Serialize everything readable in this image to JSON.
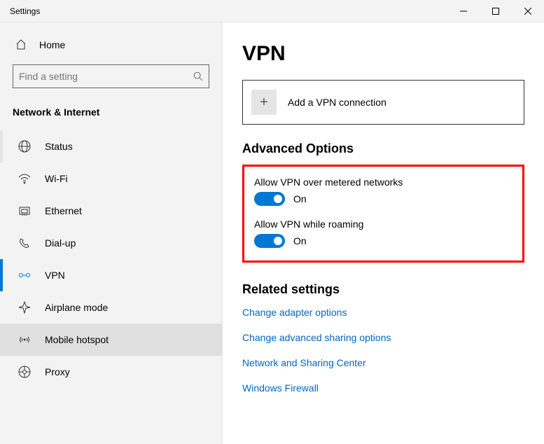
{
  "window": {
    "title": "Settings"
  },
  "sidebar": {
    "home": "Home",
    "search_placeholder": "Find a setting",
    "section": "Network & Internet",
    "items": [
      {
        "label": "Status"
      },
      {
        "label": "Wi-Fi"
      },
      {
        "label": "Ethernet"
      },
      {
        "label": "Dial-up"
      },
      {
        "label": "VPN"
      },
      {
        "label": "Airplane mode"
      },
      {
        "label": "Mobile hotspot"
      },
      {
        "label": "Proxy"
      }
    ]
  },
  "main": {
    "title": "VPN",
    "add_button": "Add a VPN connection",
    "advanced_title": "Advanced Options",
    "opt1_label": "Allow VPN over metered networks",
    "opt1_state": "On",
    "opt2_label": "Allow VPN while roaming",
    "opt2_state": "On",
    "related_title": "Related settings",
    "links": [
      "Change adapter options",
      "Change advanced sharing options",
      "Network and Sharing Center",
      "Windows Firewall"
    ]
  }
}
